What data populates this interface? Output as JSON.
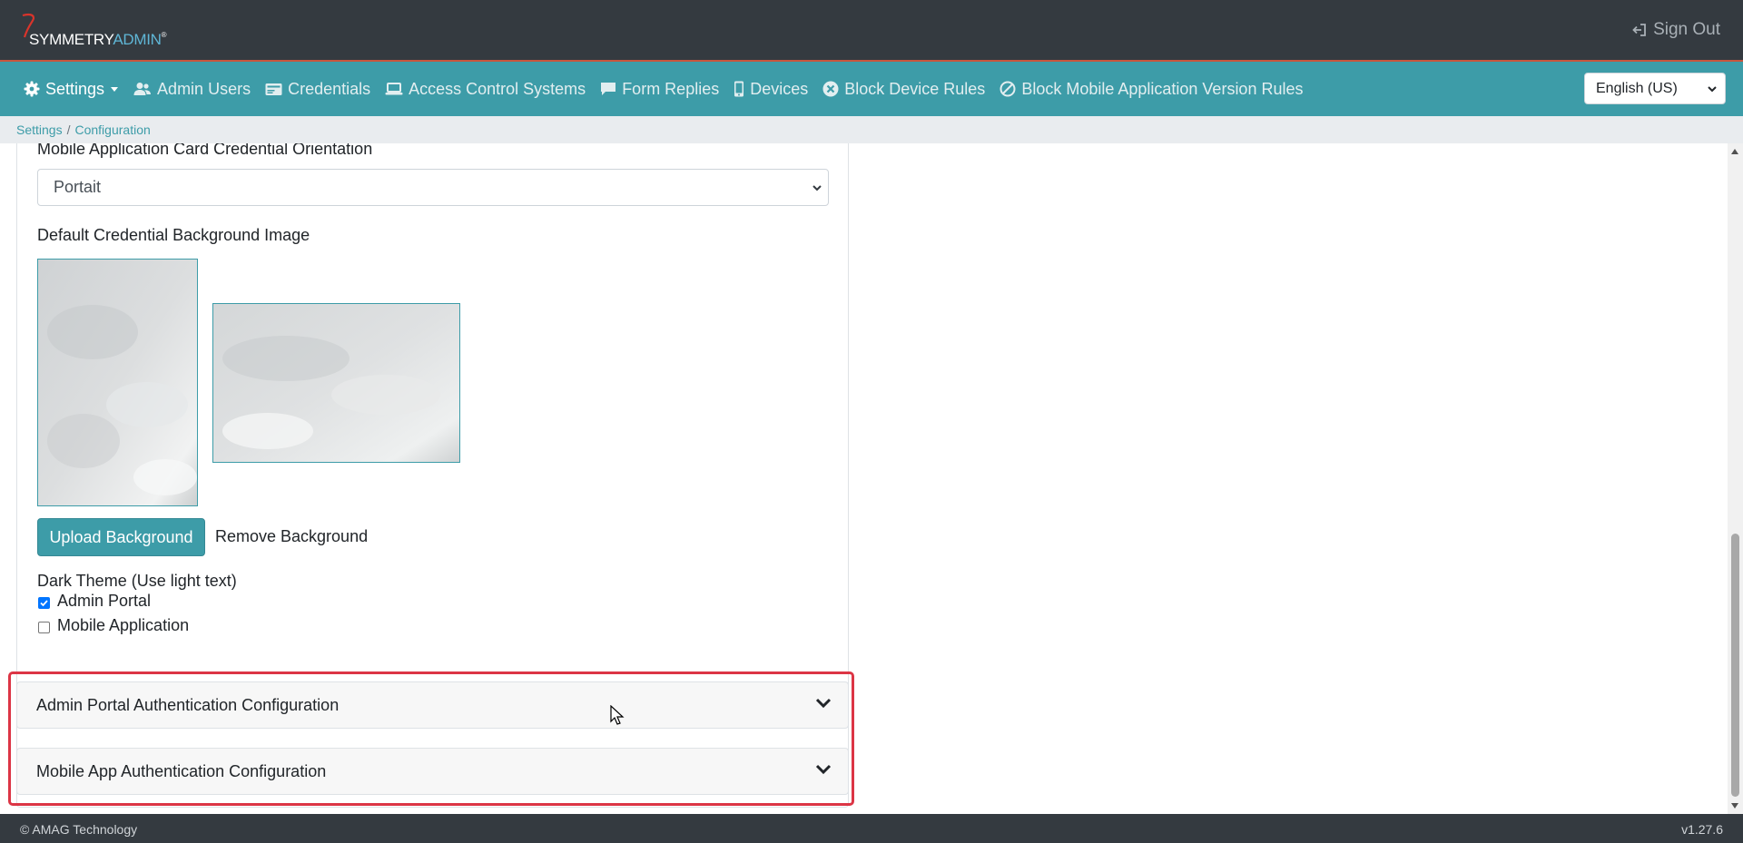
{
  "brand": {
    "name_part1": "SYMMETRY",
    "name_part2": "ADMIN",
    "trademark": "®"
  },
  "header": {
    "signout_label": "Sign Out"
  },
  "nav": {
    "items": [
      {
        "label": "Settings",
        "icon": "gear-icon",
        "active": true,
        "has_dropdown": true
      },
      {
        "label": "Admin Users",
        "icon": "users-icon"
      },
      {
        "label": "Credentials",
        "icon": "id-card-icon"
      },
      {
        "label": "Access Control Systems",
        "icon": "laptop-icon"
      },
      {
        "label": "Form Replies",
        "icon": "comment-icon"
      },
      {
        "label": "Devices",
        "icon": "mobile-icon"
      },
      {
        "label": "Block Device Rules",
        "icon": "times-circle-icon"
      },
      {
        "label": "Block Mobile Application Version Rules",
        "icon": "ban-icon"
      }
    ],
    "language": "English (US)"
  },
  "breadcrumb": {
    "items": [
      "Settings",
      "Configuration"
    ],
    "separator": "/"
  },
  "form": {
    "orientation_label": "Mobile Application Card Credential Orientation",
    "orientation_value": "Portait",
    "background_label": "Default Credential Background Image",
    "upload_label": "Upload Background",
    "remove_label": "Remove Background",
    "dark_theme_label": "Dark Theme (Use light text)",
    "checkboxes": [
      {
        "label": "Admin Portal",
        "checked": true
      },
      {
        "label": "Mobile Application",
        "checked": false
      }
    ]
  },
  "accordions": [
    {
      "title": "Admin Portal Authentication Configuration"
    },
    {
      "title": "Mobile App Authentication Configuration"
    }
  ],
  "footer": {
    "copyright": "© AMAG Technology",
    "version": "v1.27.6"
  },
  "colors": {
    "topbar": "#343a40",
    "nav": "#3d9ca8",
    "accent": "#3d9ca8",
    "highlight": "#dc3545",
    "brand_secondary": "#5fb6d6"
  }
}
